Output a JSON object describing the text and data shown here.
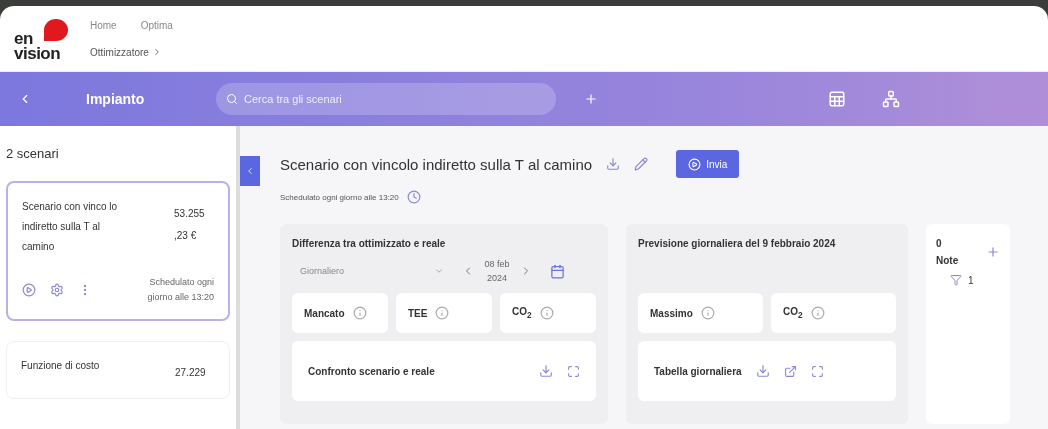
{
  "header": {
    "logo": {
      "top": "en",
      "bottom": "vision"
    },
    "nav": [
      "Home",
      "Optima"
    ],
    "breadcrumb": "Ottimizzatore"
  },
  "toolbar": {
    "title": "Impianto",
    "search": {
      "placeholder": "Cerca tra gli scenari"
    }
  },
  "sidebar": {
    "count": "2 scenari",
    "scenarios": [
      {
        "name": "Scenario con vinco lo indiretto sulla T al camino",
        "value": "53.255 ,23 €",
        "schedule": "Schedulato ogni giorno alle 13:20",
        "selected": true
      },
      {
        "name": "Funzione di costo",
        "value": "27.229",
        "selected": false
      }
    ]
  },
  "scenario": {
    "title": "Scenario con vincolo indiretto sulla T al camino",
    "schedule": "Schedulato ogni giorno alle 13:20",
    "send_button": "Invia"
  },
  "difference_panel": {
    "title": "Differenza tra ottimizzato e reale",
    "period": "Giornaliero",
    "date": "08 feb 2024",
    "kpis": [
      "Mancato",
      "TEE",
      "CO$_{2}$"
    ],
    "chart_card": {
      "title": "Confronto scenario e reale"
    }
  },
  "forecast_panel": {
    "title": "Previsione giornaliera del 9 febbraio 2024",
    "kpis": [
      "Massimo",
      "CO$_{2}$"
    ],
    "table_card": {
      "title": "Tabella giornaliera"
    }
  },
  "notes_panel": {
    "count": "0",
    "title": "Note",
    "filter_count": "1"
  }
}
